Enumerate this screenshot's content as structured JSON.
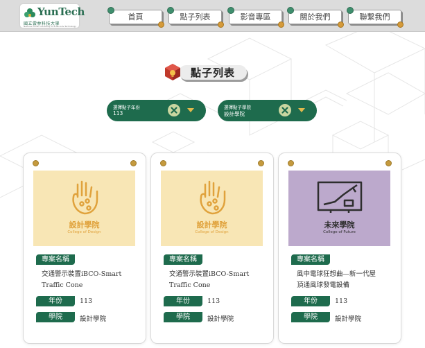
{
  "header": {
    "logo": {
      "name": "YunTech",
      "sub_cn": "國立雲林科技大學",
      "sub_en": "National Yunlin University of Science & Technology"
    },
    "nav": [
      "首頁",
      "點子列表",
      "影音專區",
      "關於我們",
      "聯繫我們"
    ]
  },
  "page": {
    "title": "點子列表"
  },
  "filters": [
    {
      "label": "選擇點子年份",
      "value": "113"
    },
    {
      "label": "選擇點子學院",
      "value": "設計學院"
    }
  ],
  "labels": {
    "project": "專案名稱",
    "year": "年份",
    "college": "學院"
  },
  "cards": [
    {
      "thumb_title": "設計學院",
      "thumb_sub": "College of Design",
      "project_line1": "交通警示裝置iBCO-Smart",
      "project_line2": "Traffic Cone",
      "year": "113",
      "college": "設計學院"
    },
    {
      "thumb_title": "設計學院",
      "thumb_sub": "College of Design",
      "project_line1": "交通警示裝置iBCO-Smart",
      "project_line2": "Traffic Cone",
      "year": "113",
      "college": "設計學院"
    },
    {
      "thumb_title": "未來學院",
      "thumb_sub": "College of Future",
      "project_line1": "風中電球狂想曲—新一代屋",
      "project_line2": "頂通風球發電設備",
      "year": "113",
      "college": "設計學院"
    }
  ],
  "colors": {
    "green": "#1e6b4d",
    "design_bg": "#f8e6b5",
    "design_fg": "#e0a23c",
    "future_bg": "#bca9cc",
    "future_fg": "#2e2e2e"
  },
  "icons": [
    "clear-icon",
    "caret-down-icon",
    "palette-hand-icon",
    "robot-icon",
    "lightbulb-icon"
  ]
}
